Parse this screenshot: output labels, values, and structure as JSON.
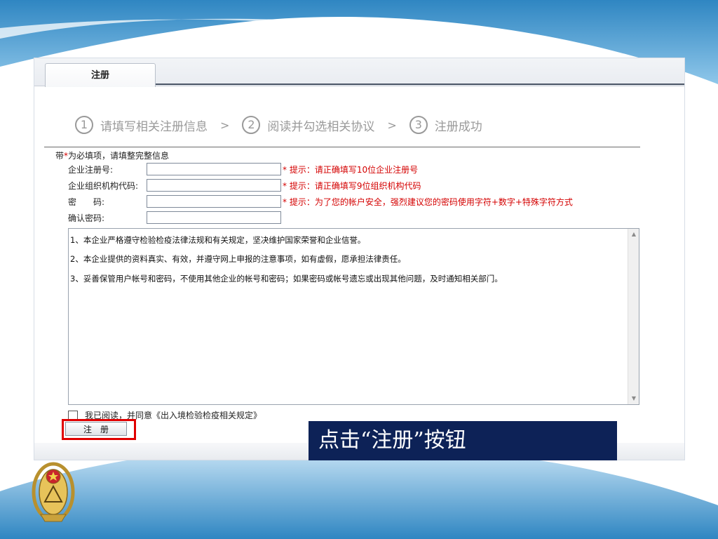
{
  "tab": {
    "label": "注册"
  },
  "steps": [
    {
      "num": "1",
      "label": "请填写相关注册信息"
    },
    {
      "num": "2",
      "label": "阅读并勾选相关协议"
    },
    {
      "num": "3",
      "label": "注册成功"
    }
  ],
  "steps_separator": ">",
  "notice": {
    "prefix": "带",
    "required_mark": "*",
    "text": "为必填项，请填整完整信息"
  },
  "form": {
    "fields": [
      {
        "label": "企业注册号:",
        "value": "",
        "hint": "* 提示：请正确填写10位企业注册号"
      },
      {
        "label": "企业组织机构代码:",
        "value": "",
        "hint": "* 提示：请正确填写9位组织机构代码"
      },
      {
        "label": "密　　码:",
        "value": "",
        "hint": "* 提示：为了您的帐户安全，强烈建议您的密码使用字符+数字+特殊字符方式"
      },
      {
        "label": "确认密码:",
        "value": "",
        "hint": ""
      }
    ]
  },
  "terms": [
    "1、本企业严格遵守检验检疫法律法规和有关规定，坚决维护国家荣誉和企业信誉。",
    "2、本企业提供的资料真实、有效，并遵守网上申报的注意事项，如有虚假，愿承担法律责任。",
    "3、妥善保管用户帐号和密码，不使用其他企业的帐号和密码；如果密码或帐号遗忘或出现其他问题，及时通知相关部门。"
  ],
  "agreement": {
    "checked": false,
    "label": "我已阅读，并同意《出入境检验检疫相关规定》"
  },
  "register_button": {
    "label": "注　册"
  },
  "callout": {
    "text": "点击“注册”按钮"
  },
  "colors": {
    "accent_red": "#d40000",
    "highlight_red": "#e00000",
    "callout_bg": "#0d2257",
    "swoosh_blue": "#3f93c9"
  }
}
